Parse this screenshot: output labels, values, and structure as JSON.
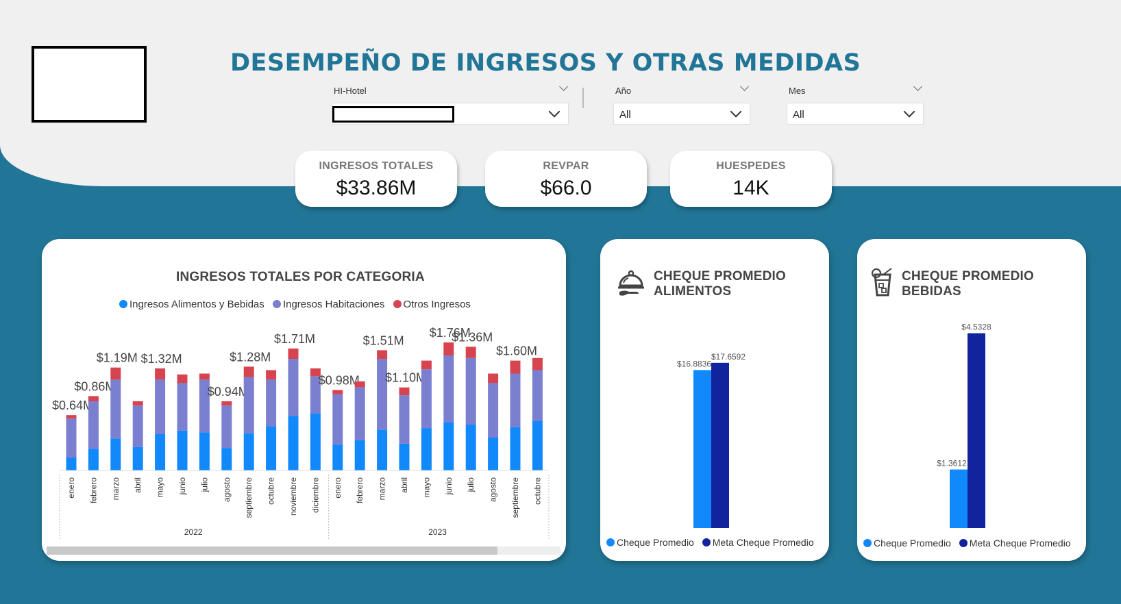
{
  "header": {
    "title": "DESEMPEÑO DE INGRESOS Y OTRAS MEDIDAS"
  },
  "filters": {
    "hotel": {
      "label": "HI-Hotel",
      "value": ""
    },
    "year": {
      "label": "Año",
      "value": "All"
    },
    "month": {
      "label": "Mes",
      "value": "All"
    }
  },
  "kpis": [
    {
      "label": "INGRESOS TOTALES",
      "value": "$33.86M"
    },
    {
      "label": "REVPAR",
      "value": "$66.0"
    },
    {
      "label": "HUESPEDES",
      "value": "14K"
    }
  ],
  "revenue_card": {
    "title": "INGRESOS TOTALES POR CATEGORIA"
  },
  "food_card": {
    "title_line1": "CHEQUE PROMEDIO",
    "title_line2": "ALIMENTOS",
    "icon": "cloche-icon"
  },
  "drinks_card": {
    "title_line1": "CHEQUE PROMEDIO",
    "title_line2": "BEBIDAS",
    "icon": "drink-glass-icon"
  },
  "colors": {
    "alimentos": "#1189fb",
    "habitaciones": "#7a7fd0",
    "otros": "#d6444f",
    "cheque": "#1189fb",
    "meta": "#12239e",
    "brand": "#217596"
  },
  "chart_data": [
    {
      "type": "bar",
      "stacked": true,
      "title": "INGRESOS TOTALES POR CATEGORIA",
      "legend": "top",
      "categories": [
        "enero",
        "febrero",
        "marzo",
        "abril",
        "mayo",
        "junio",
        "julio",
        "agosto",
        "septiembre",
        "octubre",
        "noviembre",
        "diciembre",
        "enero",
        "febrero",
        "marzo",
        "abril",
        "mayo",
        "junio",
        "julio",
        "agosto",
        "septiembre",
        "octubre"
      ],
      "groups": [
        {
          "label": "2022",
          "start": 0,
          "end": 11
        },
        {
          "label": "2023",
          "start": 12,
          "end": 21
        }
      ],
      "series": [
        {
          "name": "Ingresos Alimentos y Bebidas",
          "values": [
            0.15,
            0.25,
            0.37,
            0.27,
            0.42,
            0.46,
            0.44,
            0.26,
            0.43,
            0.51,
            0.63,
            0.66,
            0.3,
            0.35,
            0.47,
            0.31,
            0.49,
            0.56,
            0.53,
            0.38,
            0.5,
            0.57
          ]
        },
        {
          "name": "Ingresos Habitaciones",
          "values": [
            0.45,
            0.55,
            0.68,
            0.48,
            0.63,
            0.55,
            0.61,
            0.49,
            0.65,
            0.54,
            0.66,
            0.43,
            0.58,
            0.61,
            0.82,
            0.56,
            0.68,
            0.77,
            0.77,
            0.63,
            0.62,
            0.59
          ]
        },
        {
          "name": "Otros Ingresos",
          "values": [
            0.04,
            0.06,
            0.14,
            0.05,
            0.13,
            0.1,
            0.07,
            0.05,
            0.12,
            0.11,
            0.12,
            0.09,
            0.05,
            0.07,
            0.1,
            0.09,
            0.1,
            0.15,
            0.13,
            0.11,
            0.15,
            0.14
          ]
        }
      ],
      "data_labels": [
        "$0.64M",
        "$0.86M",
        "$1.19M",
        "",
        "$1.32M",
        "",
        "",
        "$0.94M",
        "$1.28M",
        "",
        "$1.71M",
        "",
        "$0.98M",
        "",
        "$1.51M",
        "$1.10M",
        "",
        "$1.76M",
        "$1.36M",
        "",
        "$1.60M",
        ""
      ],
      "ylim": [
        0,
        1.9
      ]
    },
    {
      "type": "bar",
      "title": "CHEQUE PROMEDIO ALIMENTOS",
      "legend": "bottom",
      "series": [
        {
          "name": "Cheque Promedio",
          "values": [
            16.8836
          ],
          "label": "$16.8836"
        },
        {
          "name": "Meta Cheque Promedio",
          "values": [
            17.6592
          ],
          "label": "$17.6592"
        }
      ],
      "ylim": [
        0,
        20.5
      ]
    },
    {
      "type": "bar",
      "title": "CHEQUE PROMEDIO BEBIDAS",
      "legend": "bottom",
      "series": [
        {
          "name": "Cheque Promedio",
          "values": [
            1.3612
          ],
          "label": "$1.3612"
        },
        {
          "name": "Meta Cheque Promedio",
          "values": [
            4.5328
          ],
          "label": "$4.5328"
        }
      ],
      "ylim": [
        0,
        5.1
      ]
    }
  ]
}
